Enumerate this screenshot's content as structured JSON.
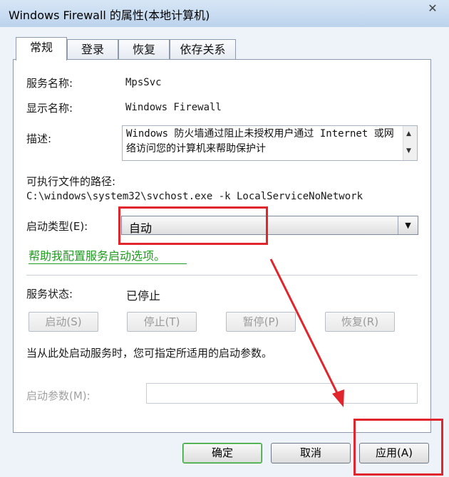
{
  "window": {
    "title": "Windows Firewall 的属性(本地计算机)",
    "close_icon": "✕"
  },
  "tabs": [
    {
      "label": "常规",
      "active": true
    },
    {
      "label": "登录",
      "active": false
    },
    {
      "label": "恢复",
      "active": false
    },
    {
      "label": "依存关系",
      "active": false
    }
  ],
  "general": {
    "service_name_label": "服务名称:",
    "service_name_value": "MpsSvc",
    "display_name_label": "显示名称:",
    "display_name_value": "Windows Firewall",
    "description_label": "描述:",
    "description_value": "Windows 防火墙通过阻止未授权用户通过 Internet 或网络访问您的计算机来帮助保护计",
    "path_label": "可执行文件的路径:",
    "path_value": "C:\\windows\\system32\\svchost.exe -k LocalServiceNoNetwork",
    "startup_type_label": "启动类型(E):",
    "startup_type_value": "自动",
    "help_link": "帮助我配置服务启动选项。",
    "status_label": "服务状态:",
    "status_value": "已停止",
    "buttons": {
      "start": "启动(S)",
      "stop": "停止(T)",
      "pause": "暂停(P)",
      "resume": "恢复(R)"
    },
    "params_hint": "当从此处启动服务时，您可指定所适用的启动参数。",
    "params_label": "启动参数(M):",
    "params_value": ""
  },
  "dialog_buttons": {
    "ok": "确定",
    "cancel": "取消",
    "apply": "应用(A)"
  },
  "colors": {
    "annotation_red": "#e0262c",
    "link_green": "#1d9c1d"
  }
}
